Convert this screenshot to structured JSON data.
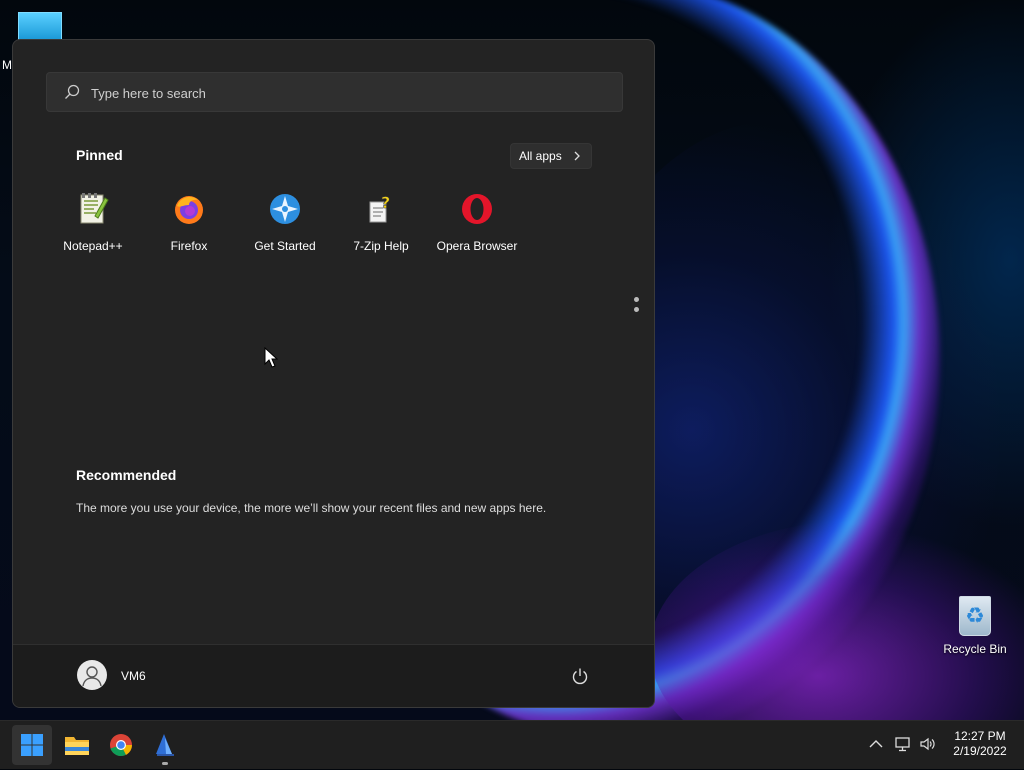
{
  "desktop": {
    "top_icon_label": "M",
    "recycle_bin_label": "Recycle Bin"
  },
  "start_menu": {
    "search": {
      "placeholder": "Type here to search",
      "icon": "search-icon"
    },
    "pinned_title": "Pinned",
    "all_apps_label": "All apps",
    "pinned_apps": [
      {
        "label": "Notepad++",
        "icon": "notepad-plus-plus-icon"
      },
      {
        "label": "Firefox",
        "icon": "firefox-icon"
      },
      {
        "label": "Get Started",
        "icon": "get-started-icon"
      },
      {
        "label": "7-Zip Help",
        "icon": "help-file-icon"
      },
      {
        "label": "Opera Browser",
        "icon": "opera-icon"
      }
    ],
    "recommended_title": "Recommended",
    "recommended_text": "The more you use your device, the more we’ll show your recent files and new apps here.",
    "user": {
      "name": "VM6",
      "icon": "user-avatar-icon"
    },
    "power_icon": "power-icon"
  },
  "taskbar": {
    "items": [
      {
        "name": "start",
        "icon": "windows-start-icon",
        "active": true
      },
      {
        "name": "file-explorer",
        "icon": "folder-icon"
      },
      {
        "name": "chrome",
        "icon": "chrome-icon"
      },
      {
        "name": "app",
        "icon": "app-sail-icon"
      }
    ],
    "tray": {
      "time": "12:27 PM",
      "date": "2/19/2022"
    }
  },
  "colors": {
    "start_bg": "#232323",
    "taskbar_bg": "#1f1f1f",
    "accent": "#3aa0ff"
  }
}
